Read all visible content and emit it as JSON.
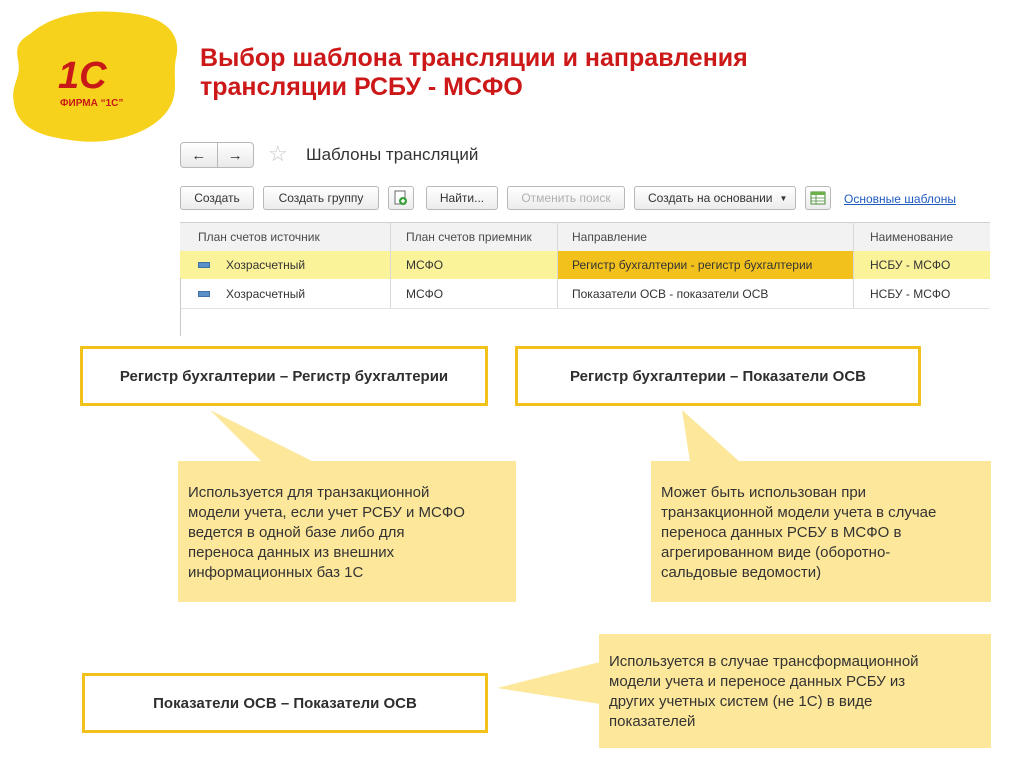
{
  "logo": {
    "brand": "1С",
    "sub": "ФИРМА “1С”"
  },
  "slide": {
    "title_line1": "Выбор шаблона трансляции и направления",
    "title_line2": "трансляции РСБУ - МСФО"
  },
  "window": {
    "title": "Шаблоны трансляций",
    "nav": {
      "back": "←",
      "forward": "→"
    },
    "toolbar": {
      "create": "Создать",
      "create_group": "Создать группу",
      "find": "Найти...",
      "cancel_search": "Отменить поиск",
      "create_based_on": "Создать на основании",
      "main_templates_link": "Основные шаблоны"
    },
    "table": {
      "columns": [
        "План счетов источник",
        "План счетов приемник",
        "Направление",
        "Наименование"
      ],
      "rows": [
        {
          "source": "Хозрасчетный",
          "target": "МСФО",
          "direction": "Регистр бухгалтерии - регистр бухгалтерии",
          "name": "НСБУ - МСФО",
          "selected": true
        },
        {
          "source": "Хозрасчетный",
          "target": "МСФО",
          "direction": "Показатели ОСВ - показатели ОСВ",
          "name": "НСБУ - МСФО",
          "selected": false
        }
      ]
    }
  },
  "callouts": {
    "reg_reg": "Регистр бухгалтерии – Регистр бухгалтерии",
    "reg_osv": "Регистр бухгалтерии – Показатели ОСВ",
    "osv_osv": "Показатели ОСВ – Показатели ОСВ"
  },
  "notes": {
    "reg_reg": [
      "Используется для транзакционной",
      "модели учета, если учет РСБУ и МСФО",
      "ведется в одной базе либо для",
      "переноса данных из внешних",
      "информационных баз 1С"
    ],
    "reg_osv": [
      "Может быть использован при",
      "транзакционной модели учета в случае",
      "переноса данных РСБУ в МСФО в",
      "агрегированном виде (оборотно-",
      "сальдовые ведомости)"
    ],
    "osv_osv": [
      "Используется в случае трансформационной",
      "модели учета и переносе данных  РСБУ из",
      "других учетных систем (не 1С) в виде",
      "показателей"
    ]
  },
  "colors": {
    "title": "#cc1818",
    "accent_yellow": "#f2c11c",
    "note_fill": "#fde79a",
    "selected_row": "#fbf39a",
    "link": "#1f5bbf"
  }
}
